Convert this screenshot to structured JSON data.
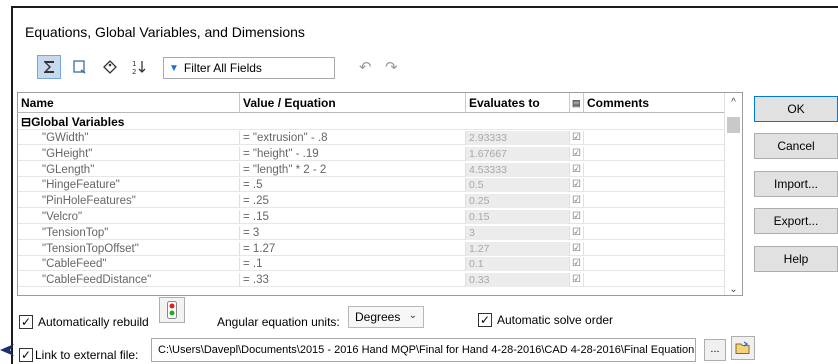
{
  "window": {
    "title": "Equations, Global Variables, and Dimensions"
  },
  "toolbar": {
    "filter_label": "Filter All Fields",
    "buttons": [
      "sum-icon",
      "filter-view-icon",
      "tag-icon",
      "sort-icon"
    ]
  },
  "table": {
    "headers": {
      "name": "Name",
      "value": "Value / Equation",
      "evaluates": "Evaluates to",
      "comments": "Comments"
    },
    "group": "Global Variables",
    "rows": [
      {
        "name": "\"GWidth\"",
        "value": "= \"extrusion\" - .8",
        "eval": "2.93333"
      },
      {
        "name": "\"GHeight\"",
        "value": "= \"height\" - .19",
        "eval": "1.67667"
      },
      {
        "name": "\"GLength\"",
        "value": "= \"length\" * 2 - 2",
        "eval": "4.53333"
      },
      {
        "name": "\"HingeFeature\"",
        "value": "= .5",
        "eval": "0.5"
      },
      {
        "name": "\"PinHoleFeatures\"",
        "value": "= .25",
        "eval": "0.25"
      },
      {
        "name": "\"Velcro\"",
        "value": "= .15",
        "eval": "0.15"
      },
      {
        "name": "\"TensionTop\"",
        "value": "= 3",
        "eval": "3"
      },
      {
        "name": "\"TensionTopOffset\"",
        "value": "= 1.27",
        "eval": "1.27"
      },
      {
        "name": "\"CableFeed\"",
        "value": "= .1",
        "eval": "0.1"
      },
      {
        "name": "\"CableFeedDistance\"",
        "value": "= .33",
        "eval": "0.33"
      }
    ]
  },
  "buttons": {
    "ok": "OK",
    "cancel": "Cancel",
    "import": "Import...",
    "export": "Export...",
    "help": "Help"
  },
  "options": {
    "auto_rebuild": "Automatically rebuild",
    "angular_units_label": "Angular equation units:",
    "angular_units_value": "Degrees",
    "auto_solve": "Automatic solve order",
    "link_external": "Link to external file:",
    "file_path": "C:\\Users\\Davepl\\Documents\\2015 - 2016 Hand MQP\\Final for Hand 4-28-2016\\CAD 4-28-2016\\Final Equation",
    "browse": "..."
  },
  "colors": {
    "accent": "#0078d7",
    "eval_bg": "#ececec",
    "active_tool": "#c6d9ee"
  }
}
